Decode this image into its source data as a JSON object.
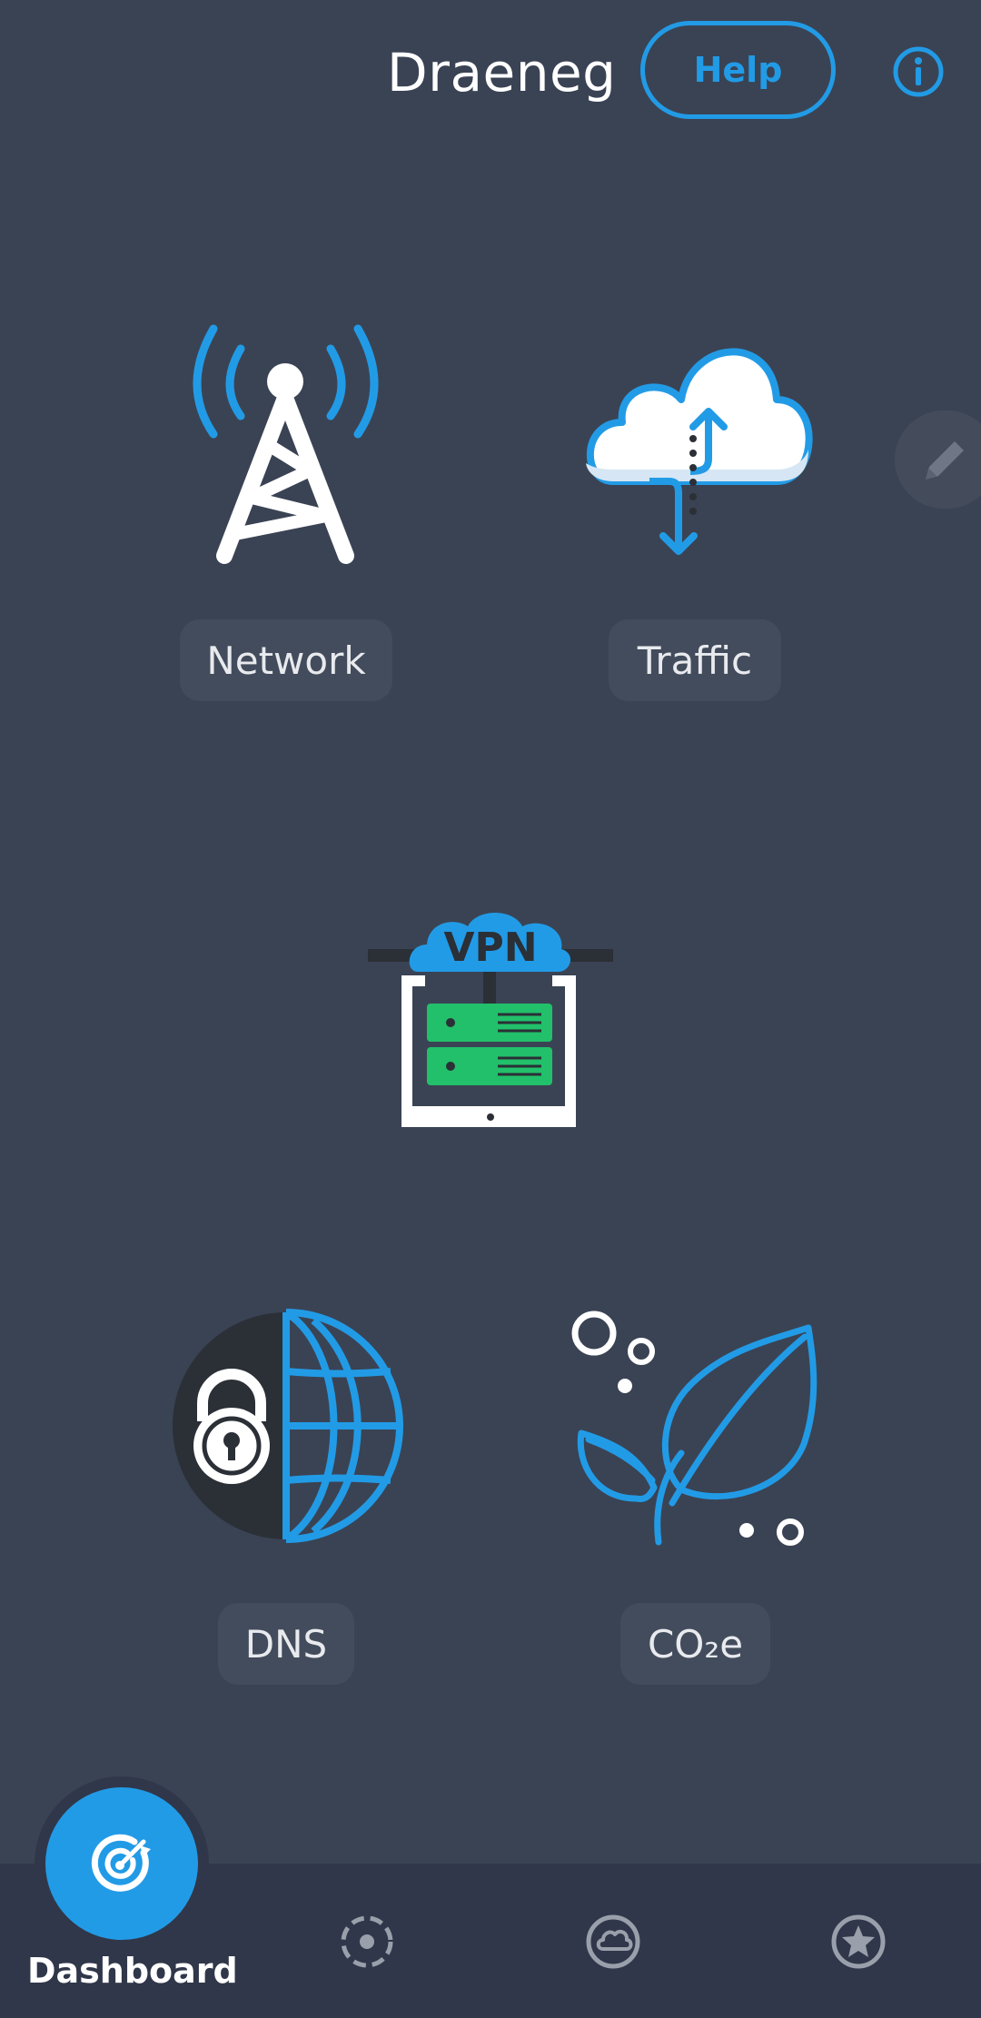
{
  "header": {
    "title": "Draeneg",
    "help_label": "Help",
    "info_icon": "info-icon"
  },
  "edit_icon": "pencil-icon",
  "tiles": [
    {
      "label": "Network",
      "icon": "network-tower-icon"
    },
    {
      "label": "Traffic",
      "icon": "cloud-traffic-icon"
    },
    {
      "label": "VPN",
      "icon": "vpn-server-icon"
    },
    {
      "label": "DNS",
      "icon": "dns-lock-globe-icon"
    },
    {
      "label": "CO₂e",
      "icon": "leaf-icon"
    }
  ],
  "bottom_nav": {
    "items": [
      {
        "label": "Dashboard",
        "icon": "dashboard-target-icon",
        "active": true
      },
      {
        "icon": "scan-icon"
      },
      {
        "icon": "cloud-icon"
      },
      {
        "icon": "star-icon"
      }
    ]
  },
  "colors": {
    "background": "#3a4354",
    "accent": "#229be6",
    "nav_background": "#30374a",
    "label_background": "#434c5c",
    "server_green": "#22c06a"
  }
}
